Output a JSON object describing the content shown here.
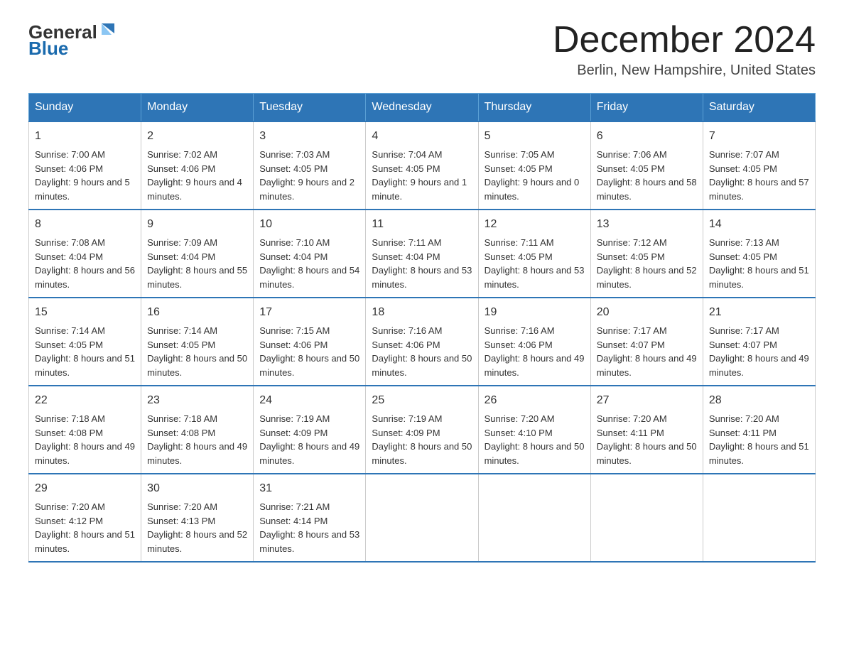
{
  "header": {
    "logo": {
      "general": "General",
      "blue": "Blue",
      "arrow_color": "#2e75b6"
    },
    "title": "December 2024",
    "subtitle": "Berlin, New Hampshire, United States"
  },
  "calendar": {
    "days_of_week": [
      "Sunday",
      "Monday",
      "Tuesday",
      "Wednesday",
      "Thursday",
      "Friday",
      "Saturday"
    ],
    "weeks": [
      [
        {
          "day": "1",
          "sunrise": "7:00 AM",
          "sunset": "4:06 PM",
          "daylight": "9 hours and 5 minutes."
        },
        {
          "day": "2",
          "sunrise": "7:02 AM",
          "sunset": "4:06 PM",
          "daylight": "9 hours and 4 minutes."
        },
        {
          "day": "3",
          "sunrise": "7:03 AM",
          "sunset": "4:05 PM",
          "daylight": "9 hours and 2 minutes."
        },
        {
          "day": "4",
          "sunrise": "7:04 AM",
          "sunset": "4:05 PM",
          "daylight": "9 hours and 1 minute."
        },
        {
          "day": "5",
          "sunrise": "7:05 AM",
          "sunset": "4:05 PM",
          "daylight": "9 hours and 0 minutes."
        },
        {
          "day": "6",
          "sunrise": "7:06 AM",
          "sunset": "4:05 PM",
          "daylight": "8 hours and 58 minutes."
        },
        {
          "day": "7",
          "sunrise": "7:07 AM",
          "sunset": "4:05 PM",
          "daylight": "8 hours and 57 minutes."
        }
      ],
      [
        {
          "day": "8",
          "sunrise": "7:08 AM",
          "sunset": "4:04 PM",
          "daylight": "8 hours and 56 minutes."
        },
        {
          "day": "9",
          "sunrise": "7:09 AM",
          "sunset": "4:04 PM",
          "daylight": "8 hours and 55 minutes."
        },
        {
          "day": "10",
          "sunrise": "7:10 AM",
          "sunset": "4:04 PM",
          "daylight": "8 hours and 54 minutes."
        },
        {
          "day": "11",
          "sunrise": "7:11 AM",
          "sunset": "4:04 PM",
          "daylight": "8 hours and 53 minutes."
        },
        {
          "day": "12",
          "sunrise": "7:11 AM",
          "sunset": "4:05 PM",
          "daylight": "8 hours and 53 minutes."
        },
        {
          "day": "13",
          "sunrise": "7:12 AM",
          "sunset": "4:05 PM",
          "daylight": "8 hours and 52 minutes."
        },
        {
          "day": "14",
          "sunrise": "7:13 AM",
          "sunset": "4:05 PM",
          "daylight": "8 hours and 51 minutes."
        }
      ],
      [
        {
          "day": "15",
          "sunrise": "7:14 AM",
          "sunset": "4:05 PM",
          "daylight": "8 hours and 51 minutes."
        },
        {
          "day": "16",
          "sunrise": "7:14 AM",
          "sunset": "4:05 PM",
          "daylight": "8 hours and 50 minutes."
        },
        {
          "day": "17",
          "sunrise": "7:15 AM",
          "sunset": "4:06 PM",
          "daylight": "8 hours and 50 minutes."
        },
        {
          "day": "18",
          "sunrise": "7:16 AM",
          "sunset": "4:06 PM",
          "daylight": "8 hours and 50 minutes."
        },
        {
          "day": "19",
          "sunrise": "7:16 AM",
          "sunset": "4:06 PM",
          "daylight": "8 hours and 49 minutes."
        },
        {
          "day": "20",
          "sunrise": "7:17 AM",
          "sunset": "4:07 PM",
          "daylight": "8 hours and 49 minutes."
        },
        {
          "day": "21",
          "sunrise": "7:17 AM",
          "sunset": "4:07 PM",
          "daylight": "8 hours and 49 minutes."
        }
      ],
      [
        {
          "day": "22",
          "sunrise": "7:18 AM",
          "sunset": "4:08 PM",
          "daylight": "8 hours and 49 minutes."
        },
        {
          "day": "23",
          "sunrise": "7:18 AM",
          "sunset": "4:08 PM",
          "daylight": "8 hours and 49 minutes."
        },
        {
          "day": "24",
          "sunrise": "7:19 AM",
          "sunset": "4:09 PM",
          "daylight": "8 hours and 49 minutes."
        },
        {
          "day": "25",
          "sunrise": "7:19 AM",
          "sunset": "4:09 PM",
          "daylight": "8 hours and 50 minutes."
        },
        {
          "day": "26",
          "sunrise": "7:20 AM",
          "sunset": "4:10 PM",
          "daylight": "8 hours and 50 minutes."
        },
        {
          "day": "27",
          "sunrise": "7:20 AM",
          "sunset": "4:11 PM",
          "daylight": "8 hours and 50 minutes."
        },
        {
          "day": "28",
          "sunrise": "7:20 AM",
          "sunset": "4:11 PM",
          "daylight": "8 hours and 51 minutes."
        }
      ],
      [
        {
          "day": "29",
          "sunrise": "7:20 AM",
          "sunset": "4:12 PM",
          "daylight": "8 hours and 51 minutes."
        },
        {
          "day": "30",
          "sunrise": "7:20 AM",
          "sunset": "4:13 PM",
          "daylight": "8 hours and 52 minutes."
        },
        {
          "day": "31",
          "sunrise": "7:21 AM",
          "sunset": "4:14 PM",
          "daylight": "8 hours and 53 minutes."
        },
        null,
        null,
        null,
        null
      ]
    ],
    "labels": {
      "sunrise": "Sunrise:",
      "sunset": "Sunset:",
      "daylight": "Daylight:"
    }
  }
}
